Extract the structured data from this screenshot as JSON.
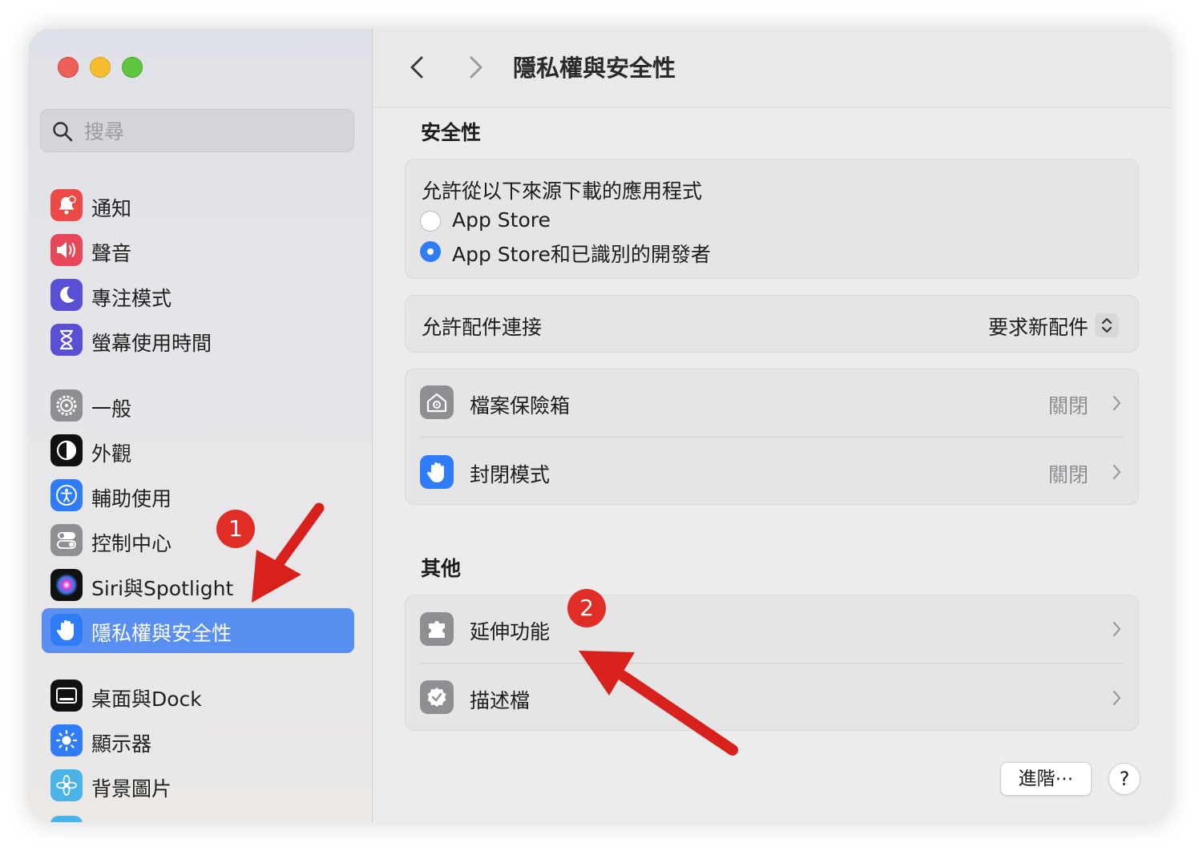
{
  "search": {
    "placeholder": "搜尋"
  },
  "sidebar": {
    "items": [
      {
        "label": "通知"
      },
      {
        "label": "聲音"
      },
      {
        "label": "專注模式"
      },
      {
        "label": "螢幕使用時間"
      },
      {
        "label": "一般"
      },
      {
        "label": "外觀"
      },
      {
        "label": "輔助使用"
      },
      {
        "label": "控制中心"
      },
      {
        "label": "Siri與Spotlight"
      },
      {
        "label": "隱私權與安全性"
      },
      {
        "label": "桌面與Dock"
      },
      {
        "label": "顯示器"
      },
      {
        "label": "背景圖片"
      }
    ]
  },
  "header": {
    "title": "隱私權與安全性"
  },
  "security": {
    "heading": "安全性",
    "allow_title": "允許從以下來源下載的應用程式",
    "options": [
      {
        "label": "App Store",
        "selected": false
      },
      {
        "label": "App Store和已識別的開發者",
        "selected": true
      }
    ],
    "accessory_label": "允許配件連接",
    "accessory_value": "要求新配件",
    "filevault_label": "檔案保險箱",
    "filevault_status": "關閉",
    "lockdown_label": "封閉模式",
    "lockdown_status": "關閉"
  },
  "other": {
    "heading": "其他",
    "extensions_label": "延伸功能",
    "profiles_label": "描述檔"
  },
  "footer": {
    "advanced_label": "進階⋯",
    "help_label": "?"
  },
  "annotations": {
    "badge1": "1",
    "badge2": "2"
  },
  "colors": {
    "accent": "#5a8ff2",
    "badge": "#e02e26",
    "arrow": "#d8201c"
  }
}
